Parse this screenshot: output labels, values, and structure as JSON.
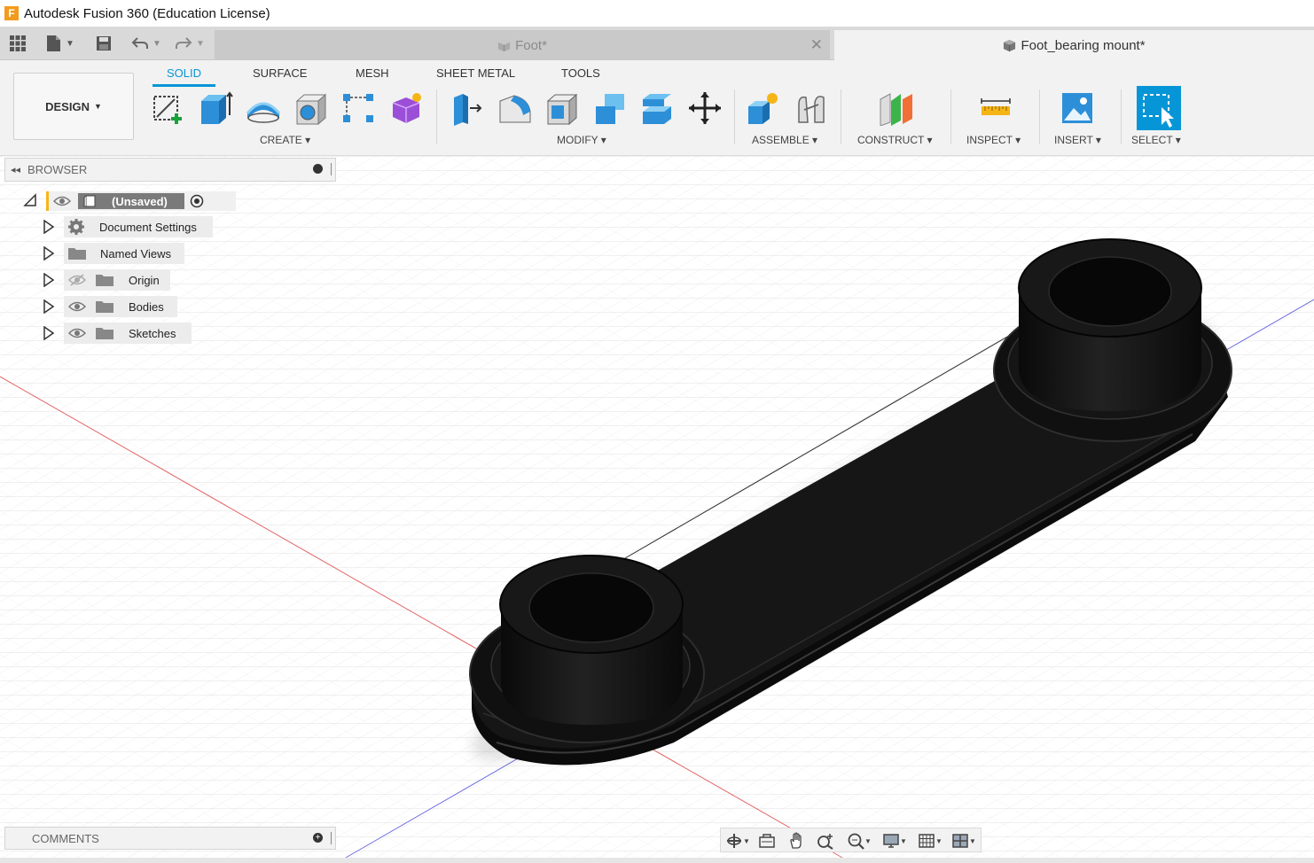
{
  "window": {
    "title": "Autodesk Fusion 360 (Education License)",
    "logo_letter": "F"
  },
  "doc_tabs": [
    {
      "label": "Foot*",
      "active": false
    },
    {
      "label": "Foot_bearing mount*",
      "active": true
    }
  ],
  "workspace": {
    "label": "DESIGN"
  },
  "ribbon_tabs": [
    "SOLID",
    "SURFACE",
    "MESH",
    "SHEET METAL",
    "TOOLS"
  ],
  "ribbon_groups": [
    "CREATE",
    "MODIFY",
    "ASSEMBLE",
    "CONSTRUCT",
    "INSPECT",
    "INSERT",
    "SELECT"
  ],
  "browser": {
    "title": "BROWSER",
    "root_label": "(Unsaved)",
    "items": [
      {
        "label": "Document Settings",
        "icon": "gear-icon"
      },
      {
        "label": "Named Views",
        "icon": "folder-icon"
      },
      {
        "label": "Origin",
        "icon": "folder-icon",
        "visibility": "hidden"
      },
      {
        "label": "Bodies",
        "icon": "folder-icon",
        "visibility": "visible"
      },
      {
        "label": "Sketches",
        "icon": "folder-icon",
        "visibility": "visible"
      }
    ]
  },
  "comments": {
    "title": "COMMENTS"
  },
  "colors": {
    "accent": "#0696d7",
    "body": "#141414",
    "x_axis": "#e04040",
    "z_axis": "#5050e0"
  }
}
